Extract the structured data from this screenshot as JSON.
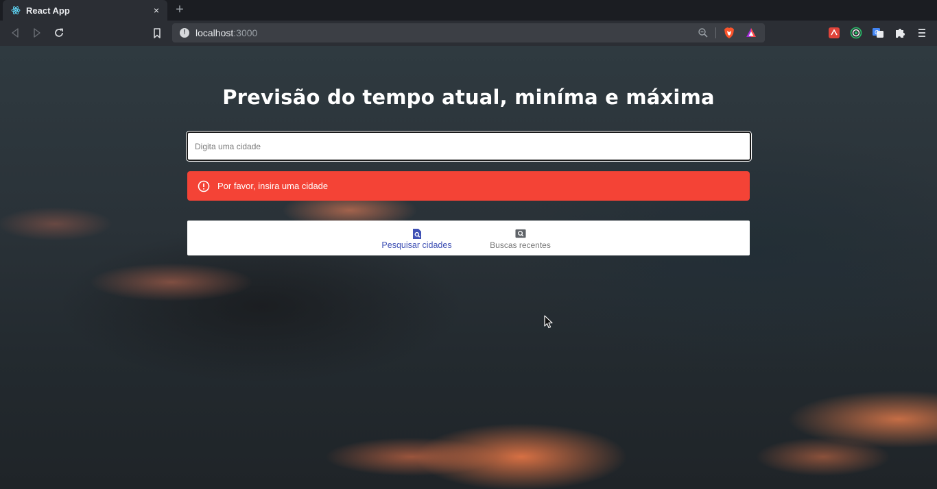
{
  "browser": {
    "tab_title": "React App",
    "tab_close": "×",
    "new_tab": "+",
    "url_host": "localhost",
    "url_port": ":3000",
    "info_icon": "!"
  },
  "page": {
    "title": "Previsão do tempo atual, miníma e máxima",
    "search_placeholder": "Digita uma cidade",
    "search_value": "",
    "alert_text": "Por favor, insira uma cidade",
    "nav": [
      {
        "label": "Pesquisar cidades",
        "icon": "search-document-icon",
        "active": true
      },
      {
        "label": "Buscas recentes",
        "icon": "image-search-icon",
        "active": false
      }
    ]
  },
  "colors": {
    "alert": "#f44336",
    "nav_active": "#3f51b5",
    "nav_inactive": "#757575"
  }
}
